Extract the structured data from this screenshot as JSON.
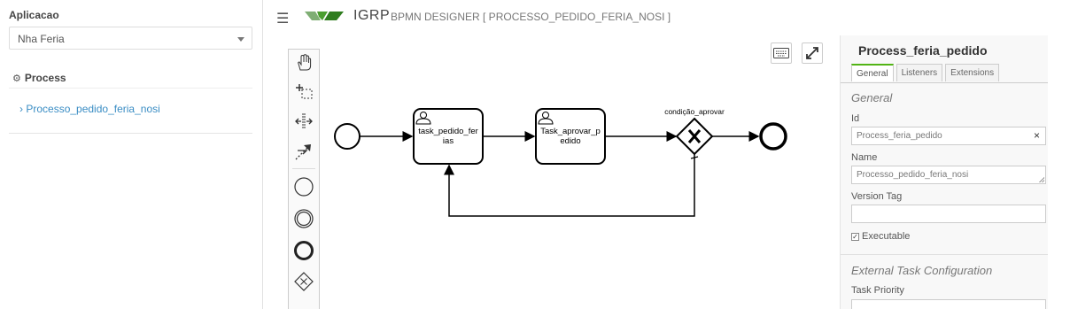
{
  "sidebar": {
    "app_label": "Aplicacao",
    "app_select_value": "Nha Feria",
    "process_heading": "Process",
    "process_items": [
      {
        "label": "Processo_pedido_feria_nosi"
      }
    ]
  },
  "header": {
    "brand": "IGRP",
    "subtitle": "BPMN DESIGNER [ PROCESSO_PEDIDO_FERIA_NOSI ]"
  },
  "diagram": {
    "tasks": [
      {
        "label_line1": "task_pedido_fer",
        "label_line2": "ias"
      },
      {
        "label_line1": "Task_aprovar_p",
        "label_line2": "edido"
      }
    ],
    "gateway_label": "condição_aprovar"
  },
  "properties": {
    "title": "Process_feria_pedido",
    "tabs": [
      "General",
      "Listeners",
      "Extensions"
    ],
    "active_tab": "General",
    "general_heading": "General",
    "id_label": "Id",
    "id_value": "Process_feria_pedido",
    "name_label": "Name",
    "name_value": "Processo_pedido_feria_nosi",
    "version_label": "Version Tag",
    "version_value": "",
    "executable_label": "Executable",
    "executable_checked": true,
    "ext_heading": "External Task Configuration",
    "priority_label": "Task Priority"
  },
  "colors": {
    "accent_green": "#52b415",
    "link_blue": "#3a8dc4",
    "logo_green": "#4a9e2e"
  }
}
